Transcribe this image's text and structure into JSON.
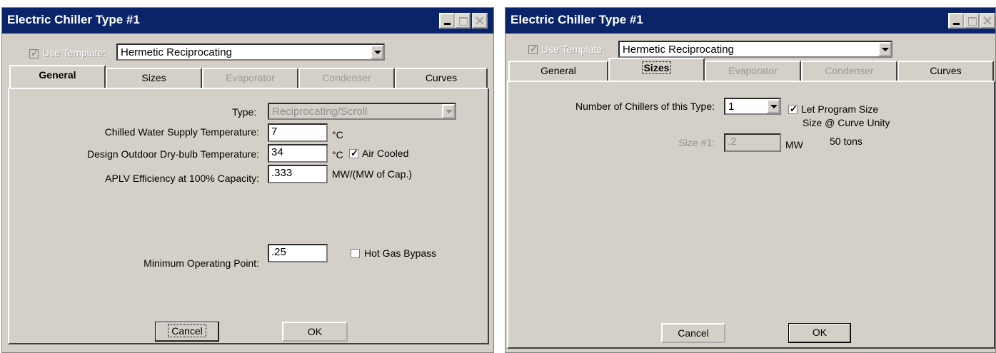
{
  "left": {
    "title": "Electric Chiller Type #1",
    "use_template_label": "Use Template:",
    "template_value": "Hermetic Reciprocating",
    "tabs": [
      "General",
      "Sizes",
      "Evaporator",
      "Condenser",
      "Curves"
    ],
    "type_label": "Type:",
    "type_value": "Reciprocating/Scroll",
    "cw_label": "Chilled Water Supply Temperature:",
    "cw_value": "7",
    "cw_unit": "°C",
    "od_label": "Design Outdoor Dry-bulb Temperature:",
    "od_value": "34",
    "od_unit": "°C",
    "air_cooled_label": "Air Cooled",
    "aplv_label": "APLV Efficiency at 100% Capacity:",
    "aplv_value": ".333",
    "aplv_unit": "MW/(MW of Cap.)",
    "min_op_label": "Minimum Operating Point:",
    "min_op_value": ".25",
    "hot_gas_label": "Hot Gas Bypass",
    "cancel": "Cancel",
    "ok": "OK"
  },
  "right": {
    "title": "Electric Chiller Type #1",
    "use_template_label": "Use Template:",
    "template_value": "Hermetic Reciprocating",
    "tabs": [
      "General",
      "Sizes",
      "Evaporator",
      "Condenser",
      "Curves"
    ],
    "num_label": "Number of Chillers of this Type:",
    "num_value": "1",
    "let_program_label": "Let Program Size",
    "curve_unity_label": "Size @ Curve Unity",
    "size_label": "Size #1:",
    "size_value": ".2",
    "size_unit": "MW",
    "tons": "50 tons",
    "cancel": "Cancel",
    "ok": "OK"
  }
}
